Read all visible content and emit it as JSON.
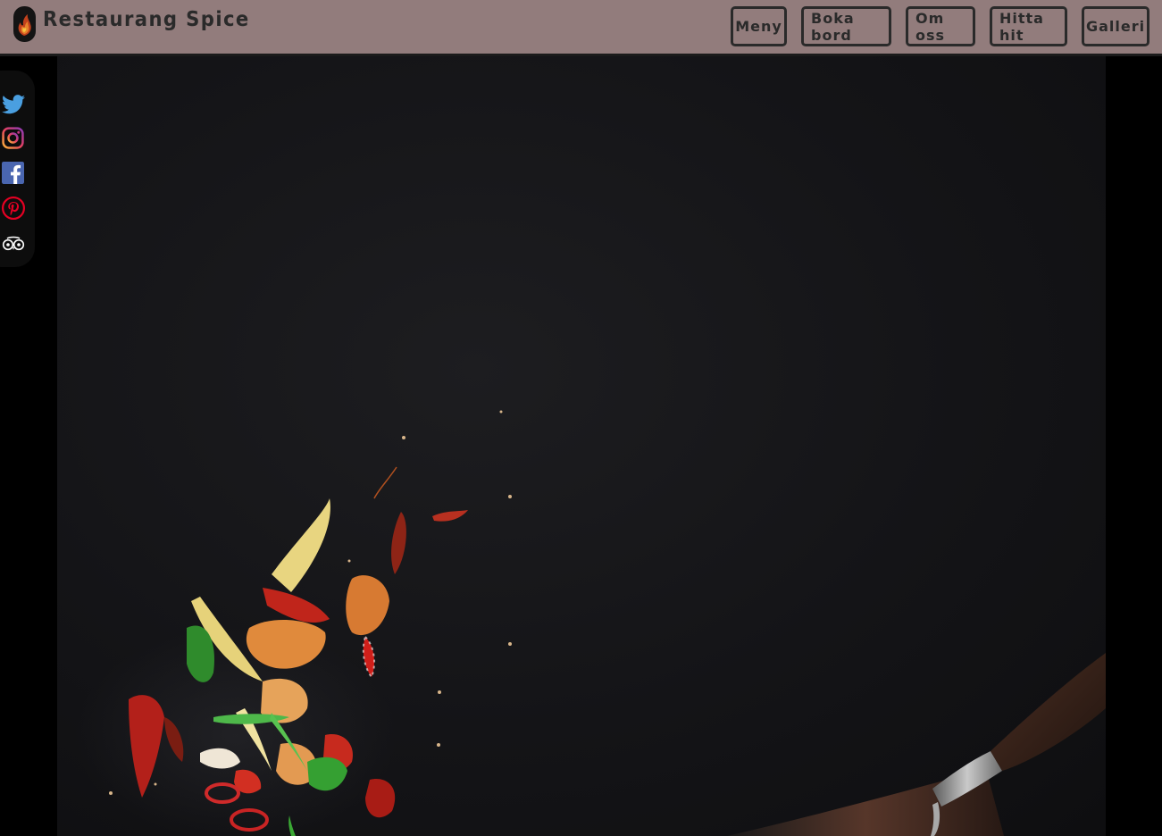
{
  "header": {
    "brand_name": "Restaurang Spice",
    "logo_icon": "flame-logo-icon",
    "background_color": "#927c7c"
  },
  "nav": {
    "items": [
      {
        "label": "Meny"
      },
      {
        "label": "Boka bord"
      },
      {
        "label": "Om oss"
      },
      {
        "label": "Hitta hit"
      },
      {
        "label": "Galleri"
      }
    ]
  },
  "social": {
    "icons": [
      "twitter-icon",
      "instagram-icon",
      "facebook-icon",
      "pinterest-icon",
      "tripadvisor-icon"
    ]
  },
  "hero": {
    "image": "wok-stir-fry-photo",
    "background_color": "#141417"
  }
}
